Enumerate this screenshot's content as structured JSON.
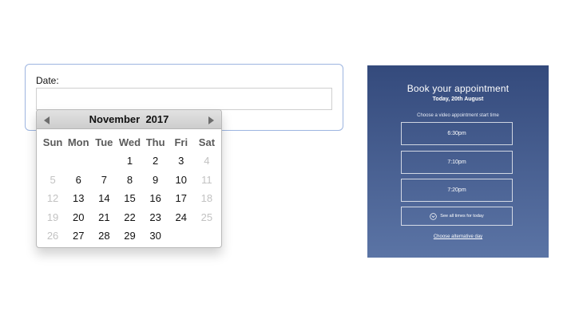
{
  "date_form": {
    "label": "Date:",
    "input_value": ""
  },
  "calendar": {
    "month": "November",
    "year": "2017",
    "weekdays": [
      "Sun",
      "Mon",
      "Tue",
      "Wed",
      "Thu",
      "Fri",
      "Sat"
    ],
    "weeks": [
      [
        {
          "d": ""
        },
        {
          "d": ""
        },
        {
          "d": ""
        },
        {
          "d": "1"
        },
        {
          "d": "2"
        },
        {
          "d": "3"
        },
        {
          "d": "4",
          "muted": true
        }
      ],
      [
        {
          "d": "5",
          "muted": true
        },
        {
          "d": "6"
        },
        {
          "d": "7"
        },
        {
          "d": "8"
        },
        {
          "d": "9"
        },
        {
          "d": "10"
        },
        {
          "d": "11",
          "muted": true
        }
      ],
      [
        {
          "d": "12",
          "muted": true
        },
        {
          "d": "13"
        },
        {
          "d": "14"
        },
        {
          "d": "15"
        },
        {
          "d": "16"
        },
        {
          "d": "17"
        },
        {
          "d": "18",
          "muted": true
        }
      ],
      [
        {
          "d": "19",
          "muted": true
        },
        {
          "d": "20"
        },
        {
          "d": "21"
        },
        {
          "d": "22"
        },
        {
          "d": "23"
        },
        {
          "d": "24"
        },
        {
          "d": "25",
          "muted": true
        }
      ],
      [
        {
          "d": "26",
          "muted": true
        },
        {
          "d": "27"
        },
        {
          "d": "28"
        },
        {
          "d": "29"
        },
        {
          "d": "30"
        },
        {
          "d": ""
        },
        {
          "d": ""
        }
      ]
    ],
    "icons": {
      "prev": "triangle-left-icon",
      "next": "triangle-right-icon"
    }
  },
  "booking": {
    "title": "Book your appointment",
    "date": "Today, 20th August",
    "instruction": "Choose a video appointment start time",
    "slots": [
      "6:30pm",
      "7:10pm",
      "7:20pm"
    ],
    "see_all": "See all times for today",
    "see_all_icon": "chevron-down-circle-icon",
    "alt_link": "Choose alternative day"
  },
  "colors": {
    "form_border": "#9db5e0",
    "panel_top": "#344a7c",
    "panel_bottom": "#5b74a5",
    "muted_day": "#c2c2c2"
  }
}
